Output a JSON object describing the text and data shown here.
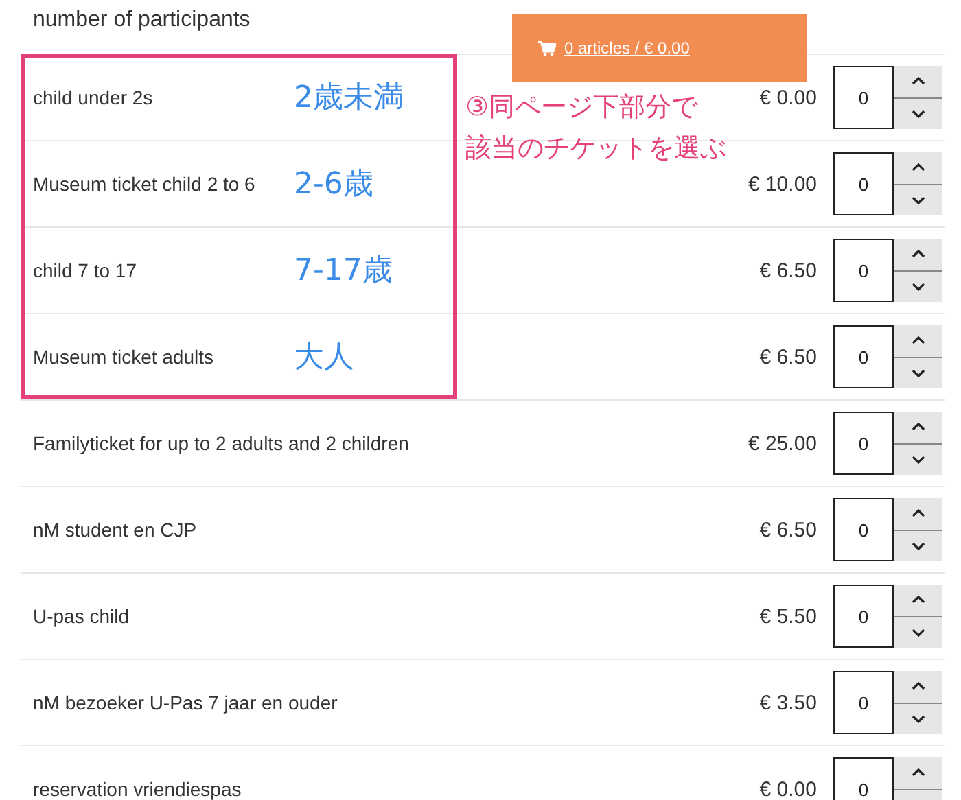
{
  "heading": "number of participants",
  "cart": {
    "label": "0 articles / € 0.00"
  },
  "instruction": {
    "lines": [
      "③同ページ下部分で",
      "該当のチケットを選ぶ"
    ]
  },
  "highlighted_rows": [
    {
      "label": "child under 2s",
      "note": "2歳未満",
      "price": "€ 0.00",
      "quantity": "0"
    },
    {
      "label": "Museum ticket child 2 to 6",
      "note": "2-6歳",
      "price": "€ 10.00",
      "quantity": "0"
    },
    {
      "label": "child 7 to 17",
      "note": "7-17歳",
      "price": "€ 6.50",
      "quantity": "0"
    },
    {
      "label": "Museum ticket adults",
      "note": "大人",
      "price": "€ 6.50",
      "quantity": "0"
    }
  ],
  "rows": [
    {
      "label": "Familyticket for up to 2 adults and 2 children",
      "price": "€ 25.00",
      "quantity": "0"
    },
    {
      "label": "nM student en CJP",
      "price": "€ 6.50",
      "quantity": "0"
    },
    {
      "label": "U-pas child",
      "price": "€ 5.50",
      "quantity": "0"
    },
    {
      "label": "nM bezoeker U-Pas 7 jaar en ouder",
      "price": "€ 3.50",
      "quantity": "0"
    },
    {
      "label": "reservation vriendiespas",
      "price": "€ 0.00",
      "quantity": "0"
    }
  ]
}
